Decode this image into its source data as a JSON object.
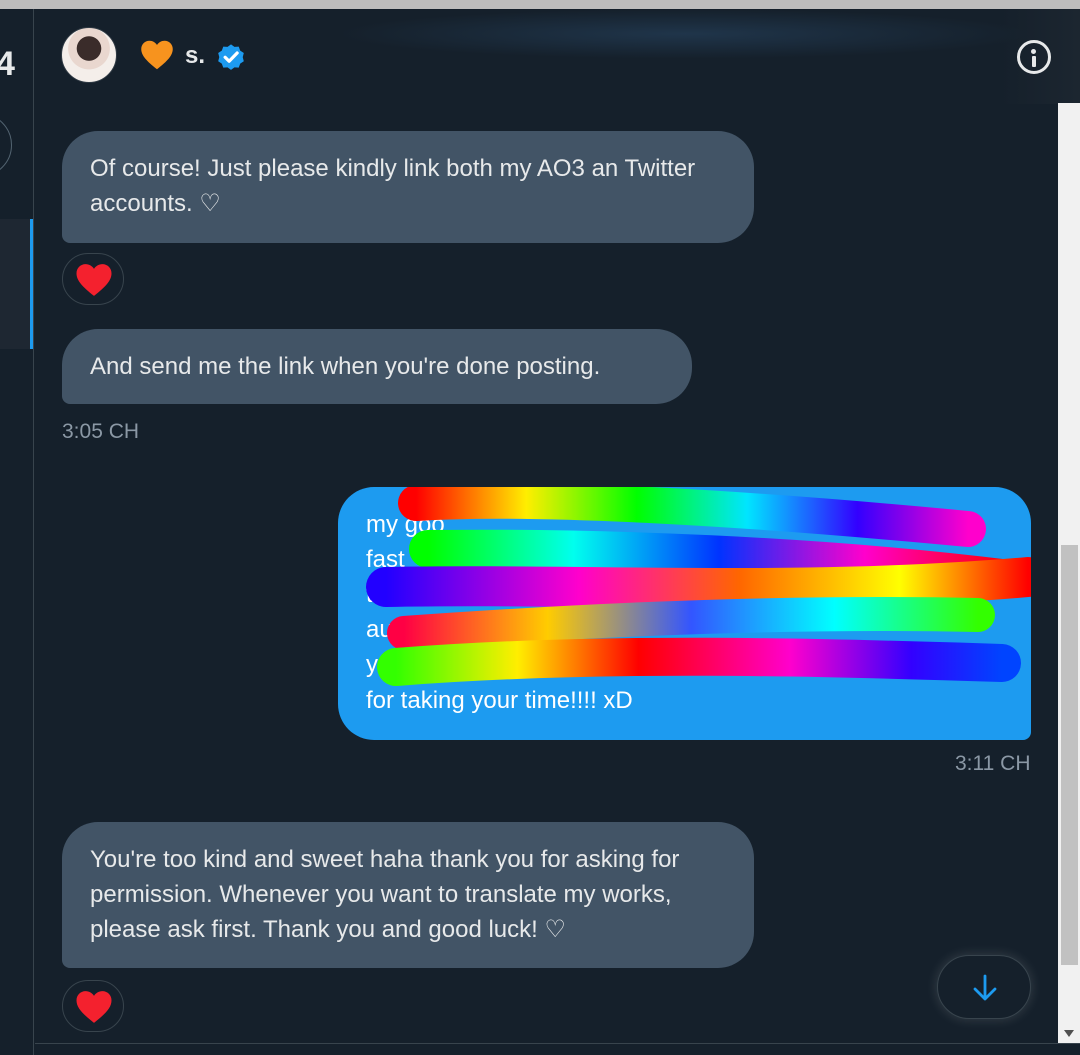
{
  "header": {
    "name": "s.",
    "name_icon": "orange-heart-icon",
    "verified_icon": "verified-badge-icon",
    "info_icon": "info-icon",
    "rail_glyph": "4"
  },
  "messages": [
    {
      "direction": "received",
      "text": "Of course! Just please kindly link both my AO3 an Twitter accounts. ♡",
      "reaction": "red-heart-icon"
    },
    {
      "direction": "received",
      "text": "And send me the link when you're done posting.",
      "timestamp": "3:05 CH"
    },
    {
      "direction": "sent",
      "visible_fragments": [
        "my goo",
        "fast",
        "t",
        "au",
        "y"
      ],
      "text_last_line": "for taking your time!!!! xD",
      "timestamp": "3:11 CH",
      "redacted": true
    },
    {
      "direction": "received",
      "text": "You're too kind and sweet haha thank you for asking for permission. Whenever you want to translate my works, please ask first. Thank you and good luck! ♡",
      "reaction": "red-heart-icon"
    }
  ],
  "controls": {
    "scroll_down_icon": "arrow-down-icon"
  },
  "colors": {
    "background": "#15202b",
    "received_bubble": "#425466",
    "sent_bubble": "#1d9bf0",
    "accent": "#1d9bf0",
    "reaction_heart": "#f4212e",
    "timestamp": "#8b98a5"
  }
}
